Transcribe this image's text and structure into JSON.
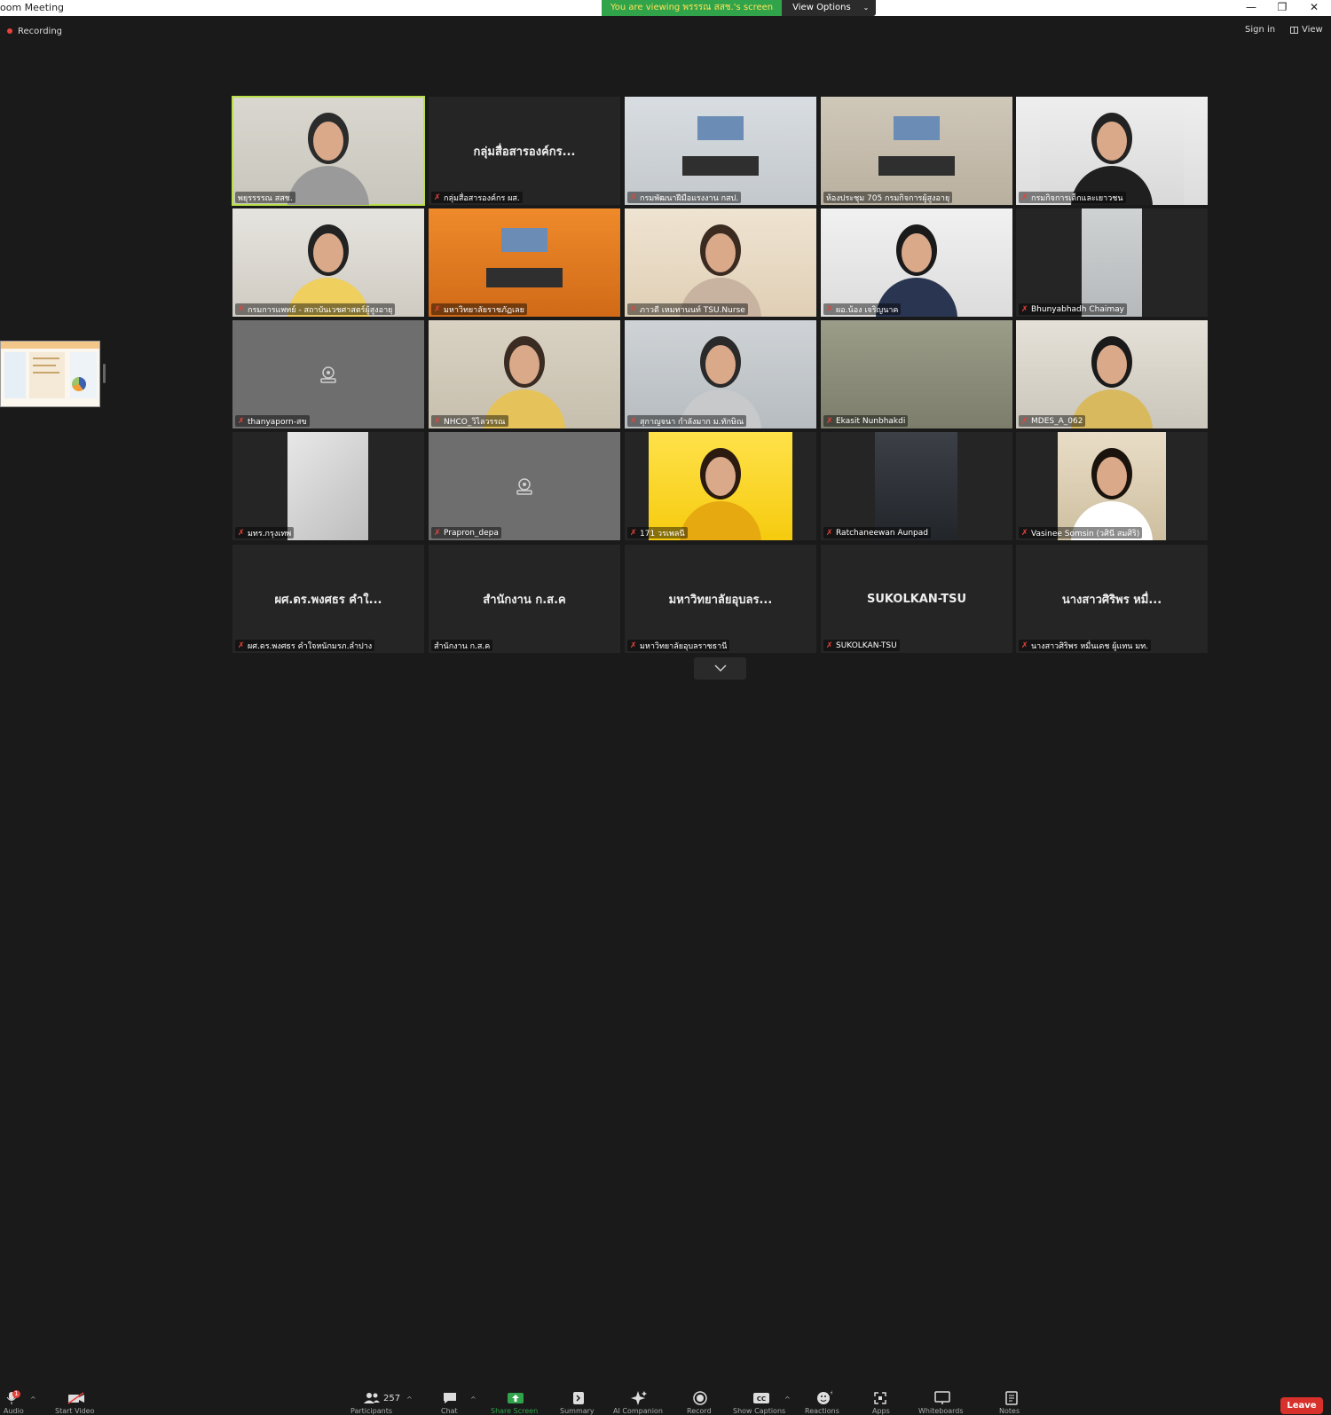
{
  "window": {
    "title": "oom Meeting",
    "share_banner": "You are viewing พรรรณ สสช.'s screen",
    "view_options": "View Options",
    "minimize": "—",
    "restore": "❐",
    "close": "✕"
  },
  "topbar": {
    "recording": "Recording",
    "sign_in": "Sign in",
    "view": "View"
  },
  "participants": [
    {
      "name": "พยุรรรรณ สสช.",
      "muted": false,
      "active": true,
      "big": ""
    },
    {
      "name": "กลุ่มสื่อสารองค์กร ผส.",
      "muted": true,
      "big": "กลุ่มสื่อสารองค์กร..."
    },
    {
      "name": "กรมพัฒนาฝีมือแรงงาน กสป.",
      "muted": true,
      "big": ""
    },
    {
      "name": "ห้องประชุม 705 กรมกิจการผู้สูงอายุ",
      "muted": false,
      "big": ""
    },
    {
      "name": "กรมกิจการเด็กและเยาวชน",
      "muted": true,
      "big": ""
    },
    {
      "name": "กรมการแพทย์ - สถาบันเวชศาสตร์ผู้สูงอายุ",
      "muted": true,
      "big": ""
    },
    {
      "name": "มหาวิทยาลัยราชภัฏเลย",
      "muted": true,
      "big": ""
    },
    {
      "name": "ภาวดี เหมทานนท์ TSU.Nurse",
      "muted": true,
      "big": ""
    },
    {
      "name": "ผอ.น้อง เจริญนาค",
      "muted": true,
      "big": ""
    },
    {
      "name": "Bhunyabhadh Chaimay",
      "muted": true,
      "big": ""
    },
    {
      "name": "thanyaporn-สข",
      "muted": true,
      "big": ""
    },
    {
      "name": "NHCO_วิไลวรรณ",
      "muted": true,
      "big": ""
    },
    {
      "name": "สุกาญจนา กำลังมาก ม.ทักษิณ",
      "muted": true,
      "big": ""
    },
    {
      "name": "Ekasit Nunbhakdi",
      "muted": true,
      "big": ""
    },
    {
      "name": "MDES_A_062",
      "muted": true,
      "big": ""
    },
    {
      "name": "มทร.กรุงเทพ",
      "muted": true,
      "big": ""
    },
    {
      "name": "Prapron_depa",
      "muted": true,
      "big": ""
    },
    {
      "name": "171 วรเพลนี",
      "muted": true,
      "big": ""
    },
    {
      "name": "Ratchaneewan Aunpad",
      "muted": true,
      "big": ""
    },
    {
      "name": "Vasinee Somsin (วศินี สมศิริ)",
      "muted": true,
      "big": ""
    },
    {
      "name": "ผศ.ดร.พงศธร คำใจหนักมรภ.ลำปาง",
      "muted": true,
      "big": "ผศ.ดร.พงศธร คำใ..."
    },
    {
      "name": "สำนักงาน ก.ส.ค",
      "muted": false,
      "big": "สำนักงาน ก.ส.ค"
    },
    {
      "name": "มหาวิทยาลัยอุบลราชธานี",
      "muted": true,
      "big": "มหาวิทยาลัยอุบลร..."
    },
    {
      "name": "SUKOLKAN-TSU",
      "muted": true,
      "big": "SUKOLKAN-TSU"
    },
    {
      "name": "นางสาวศิริพร หมื่นเดช ผู้แทน มท.",
      "muted": true,
      "big": "นางสาวศิริพร หมื่..."
    }
  ],
  "toolbar": {
    "audio_label": "Audio",
    "audio_badge": "1",
    "video_label": "Start Video",
    "participants_count": "257",
    "participants_label": "Participants",
    "chat_label": "Chat",
    "share_label": "Share Screen",
    "summary_label": "Summary",
    "ai_label": "AI Companion",
    "record_label": "Record",
    "captions_label": "Show Captions",
    "reactions_label": "Reactions",
    "apps_label": "Apps",
    "whiteboards_label": "Whiteboards",
    "notes_label": "Notes",
    "leave_label": "Leave"
  },
  "colors": {
    "accent_green": "#31a34a",
    "active_outline": "#b9e04a",
    "leave_red": "#d8302a",
    "muted_red": "#e8423a"
  }
}
